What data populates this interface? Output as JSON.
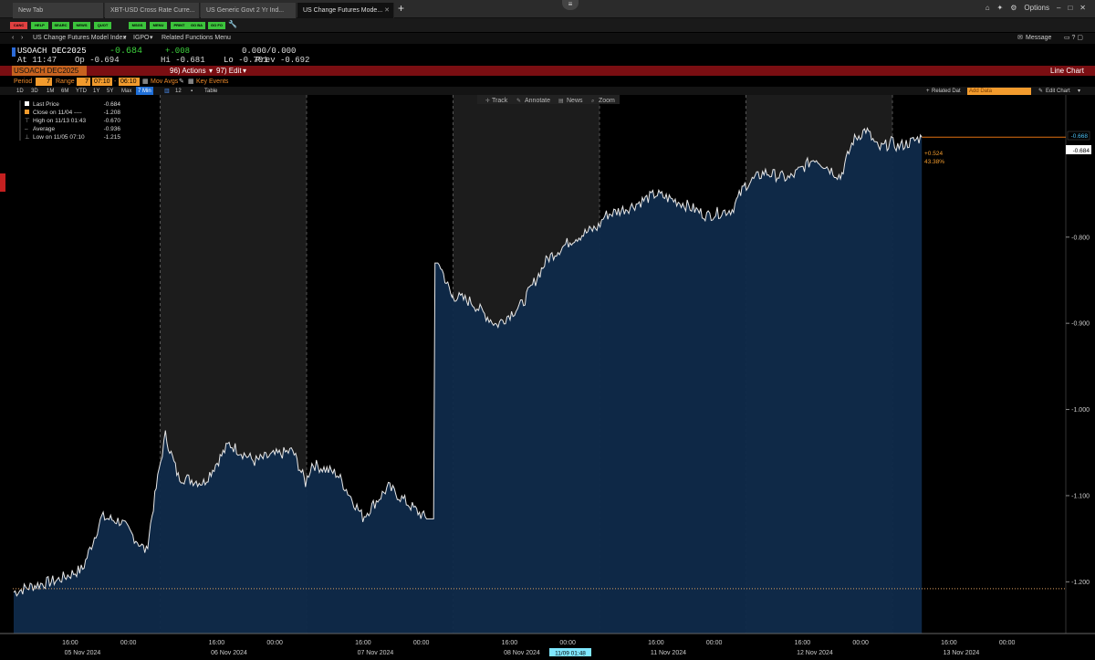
{
  "tabs": [
    {
      "label": "New Tab"
    },
    {
      "label": "XBT-USD Cross Rate Curre..."
    },
    {
      "label": "US Generic Govt 2 Yr Ind..."
    },
    {
      "label": "US Change Futures Mode..."
    }
  ],
  "toolbar": {
    "options_label": "Options"
  },
  "function_keys": [
    "CANC",
    "HELP",
    "SEARC",
    "NEWS",
    "QUOT",
    "MSGS",
    "MENU",
    "PRINT",
    "GO BA",
    "GO FO"
  ],
  "command": {
    "security": "US Change Futures Model Index",
    "igpo": "IGPO",
    "related": "Related Functions Menu",
    "message": "Message"
  },
  "quote": {
    "ticker": "USOACH DEC2025",
    "last": "-0.684",
    "change": "+.008",
    "bidask": "0.000/0.000",
    "time": "At 11:47",
    "open": "Op -0.694",
    "high": "Hi -0.681",
    "low": "Lo -0.701",
    "prev": "Prev -0.692"
  },
  "title_bar": {
    "ticker_box": "USOACH DEC2025 In",
    "actions": "96) Actions",
    "edit": "97) Edit",
    "chart_type": "Line Chart"
  },
  "period_row": {
    "period_label": "Period",
    "period_value": "7",
    "range_label": "Range",
    "range_value": "7",
    "range_from": "07:10",
    "range_to": "06:10",
    "mov_avgs": "Mov Avgs",
    "key_events": "Key Events",
    "related_data": "Related Dat",
    "add_data": "Add Data",
    "edit_chart": "Edit Chart"
  },
  "range_buttons": [
    "1D",
    "3D",
    "1M",
    "6M",
    "YTD",
    "1Y",
    "5Y",
    "Max",
    "7 Min"
  ],
  "range_extra": {
    "interval": "12",
    "table": "Table"
  },
  "chart_tools": [
    "Track",
    "Annotate",
    "News",
    "Zoom"
  ],
  "legend": [
    {
      "label": "Last Price",
      "value": "-0.684"
    },
    {
      "label": "Close on 11/04 ----",
      "value": "-1.208"
    },
    {
      "label": "High on 11/13 01:43",
      "value": "-0.670"
    },
    {
      "label": "Average",
      "value": "-0.936"
    },
    {
      "label": "Low on 11/05 07:10",
      "value": "-1.215"
    }
  ],
  "price_tags": {
    "last": "-0.684",
    "high": "-0.668",
    "change": "+0.524",
    "change_pct": "43.38%"
  },
  "cursor_label": "11/09 01:48",
  "colors": {
    "accent": "#f29b2d",
    "title_bar": "#7a0e12",
    "area_fill": "#0f2a4a",
    "line": "#e8e8e8",
    "up": "#3dd23d"
  },
  "chart_data": {
    "type": "area",
    "title": "",
    "xlabel": "",
    "ylabel": "",
    "ylim": [
      -1.26,
      -0.635
    ],
    "yticks": [
      -0.7,
      -0.8,
      -0.9,
      -1.0,
      -1.1,
      -1.2
    ],
    "ytick_labels": [
      "-0.700",
      "-0.800",
      "-0.900",
      "-1.000",
      "-1.100",
      "-1.200"
    ],
    "reference_line": -1.208,
    "days": [
      "05 Nov 2024",
      "06 Nov 2024",
      "07 Nov 2024",
      "08 Nov 2024",
      "11 Nov 2024",
      "12 Nov 2024",
      "13 Nov 2024"
    ],
    "time_ticks": [
      "16:00",
      "00:00"
    ],
    "x": [
      "11/05 07:10",
      "11/05 10:00",
      "11/05 14:00",
      "11/05 18:00",
      "11/05 21:00",
      "11/06 00:00",
      "11/06 04:00",
      "11/06 06:00",
      "11/06 08:00",
      "11/06 10:00",
      "11/06 14:00",
      "11/06 18:00",
      "11/06 22:00",
      "11/07 00:00",
      "11/07 04:00",
      "11/07 06:00",
      "11/07 08:00",
      "11/07 12:00",
      "11/07 16:00",
      "11/07 20:00",
      "11/08 00:00",
      "11/08 02:00",
      "11/08 04:00",
      "11/08 06:00",
      "11/08 07:00",
      "11/08 10:00",
      "11/08 14:00",
      "11/08 18:00",
      "11/08 22:00",
      "11/09 02:00",
      "11/09 06:00",
      "11/11 08:00",
      "11/11 12:00",
      "11/11 16:00",
      "11/11 20:00",
      "11/12 00:00",
      "11/12 04:00",
      "11/12 06:00",
      "11/12 10:00",
      "11/12 14:00",
      "11/12 18:00",
      "11/12 22:00",
      "11/13 00:00",
      "11/13 02:00",
      "11/13 04:00",
      "11/13 06:00",
      "11/13 08:00",
      "11/13 10:00",
      "11/13 11:47"
    ],
    "values": [
      -1.212,
      -1.205,
      -1.198,
      -1.185,
      -1.125,
      -1.13,
      -1.165,
      -1.07,
      -1.03,
      -1.078,
      -1.085,
      -1.04,
      -1.06,
      -1.055,
      -1.048,
      -1.085,
      -1.063,
      -1.075,
      -1.125,
      -1.09,
      -1.115,
      -1.127,
      -0.83,
      -0.87,
      -0.868,
      -0.875,
      -0.902,
      -0.878,
      -0.825,
      -0.802,
      -0.788,
      -0.775,
      -0.765,
      -0.75,
      -0.76,
      -0.775,
      -0.768,
      -0.74,
      -0.725,
      -0.732,
      -0.708,
      -0.73,
      -0.688,
      -0.675,
      -0.698,
      -0.69,
      -0.695,
      -0.69,
      -0.684
    ]
  }
}
